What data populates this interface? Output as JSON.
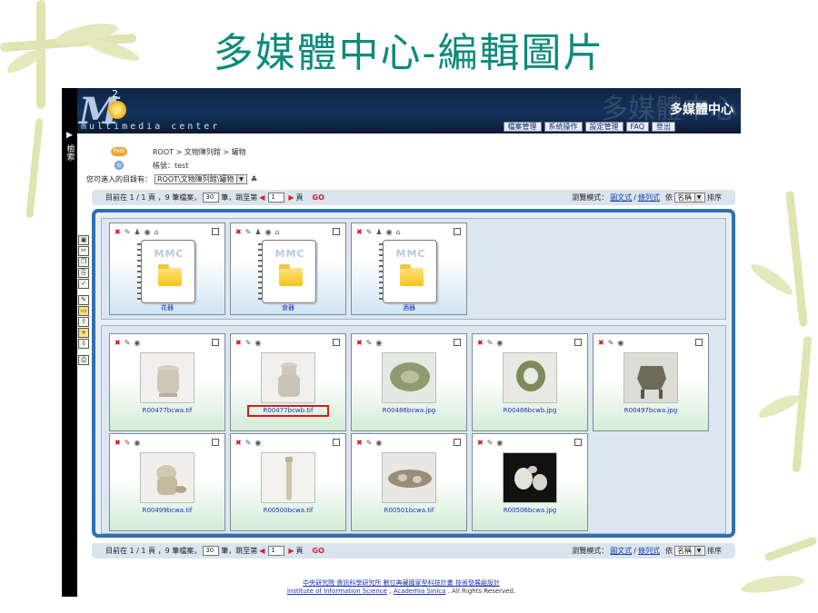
{
  "slide_title": "多媒體中心-編輯圖片",
  "left_strip": {
    "arrow": "▶",
    "label": "檢索"
  },
  "banner": {
    "logo_letter": "M",
    "logo_sup": "2",
    "subtitle": "multimedia center",
    "ghost_text": "多媒體中心",
    "center_name": "多媒體中心"
  },
  "top_nav": [
    "檔案管理",
    "系統操作",
    "設定管理",
    "FAQ",
    "登出"
  ],
  "path": {
    "badge": "Path",
    "breadcrumb": "ROOT > 文物陳列館 > 罐物",
    "unit": "帳號：test"
  },
  "target": {
    "label": "您可進入的目錄有：",
    "value": "ROOT\\文物陳列館\\罐物"
  },
  "pager": {
    "text1": "目前在 1 / 1 頁 ，9 筆檔案，",
    "per_page": "30",
    "text2": "筆，跳至第",
    "page": "1",
    "text3": "頁",
    "go": "GO",
    "mode_label": "瀏覽模式：",
    "mode_image": "圖文式",
    "sep": "/",
    "mode_list": "條列式",
    "sort_by": "依",
    "sort_value": "名稱",
    "sort_suffix": "排序"
  },
  "toolbar_icons": [
    "image-icon",
    "cut-icon",
    "copy-icon",
    "paste-icon",
    "check-icon",
    "edit-icon",
    "folder-icon",
    "upload-icon",
    "add-folder-icon",
    "download-icon",
    "print-icon"
  ],
  "folders": [
    {
      "label": "花器",
      "mark": "MMC"
    },
    {
      "label": "食器",
      "mark": "MMC"
    },
    {
      "label": "酒器",
      "mark": "MMC"
    }
  ],
  "files": [
    {
      "name": "R00477bcwa.tif",
      "selected": false
    },
    {
      "name": "R00477bcwb.tif",
      "selected": true
    },
    {
      "name": "R00486bcwa.jpg",
      "selected": false
    },
    {
      "name": "R00486bcwb.jpg",
      "selected": false
    },
    {
      "name": "R00497bcwa.jpg",
      "selected": false
    },
    {
      "name": "R00499bcwa.tif",
      "selected": false
    },
    {
      "name": "R00500bcwa.tif",
      "selected": false
    },
    {
      "name": "R00501bcwa.tif",
      "selected": false
    },
    {
      "name": "R00506bcwa.jpg",
      "selected": false
    }
  ],
  "footer": {
    "line1": "中央研究院 資訊科學研究所 數位典藏國家型科技計畫 技術發展組設計",
    "line2_link1": "Institute of Information Science",
    "line2_sep": " , ",
    "line2_link2": "Academia Sinica",
    "line2_tail": " . All Rights Reserved."
  },
  "colors": {
    "title": "#0c8a7a",
    "frame": "#2f6fb2",
    "link": "#1e2fb3",
    "delete": "#d10f0f",
    "highlight": "#e01818"
  }
}
